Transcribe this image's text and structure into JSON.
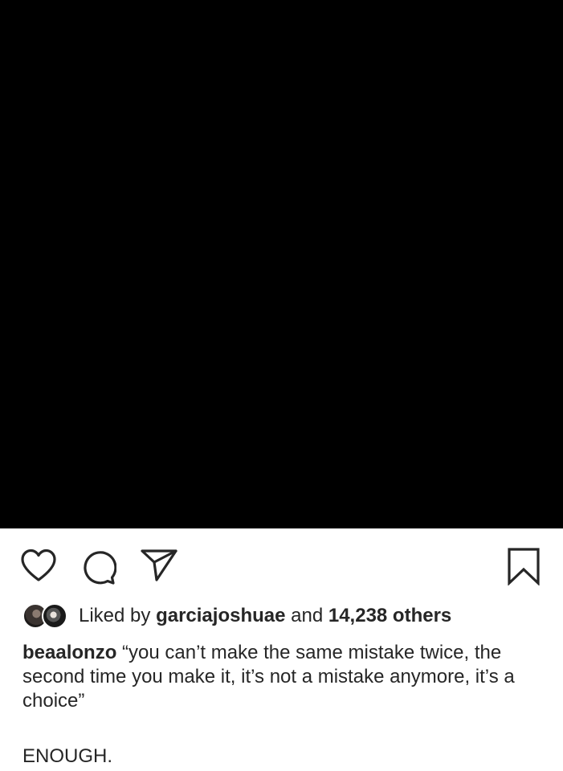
{
  "post": {
    "image_color": "#000000"
  },
  "actions": {
    "like_icon": "heart-icon",
    "comment_icon": "comment-bubble-icon",
    "share_icon": "paper-plane-icon",
    "save_icon": "bookmark-icon"
  },
  "likes": {
    "prefix": "Liked by",
    "user": "garciajoshuae",
    "joiner": "and",
    "count_text": "14,238 others"
  },
  "caption": {
    "username": "beaalonzo",
    "text": "“you can’t make the same mistake twice, the second time you make it, it’s not a mistake anymore, it’s a choice”",
    "extra_line": "ENOUGH."
  }
}
